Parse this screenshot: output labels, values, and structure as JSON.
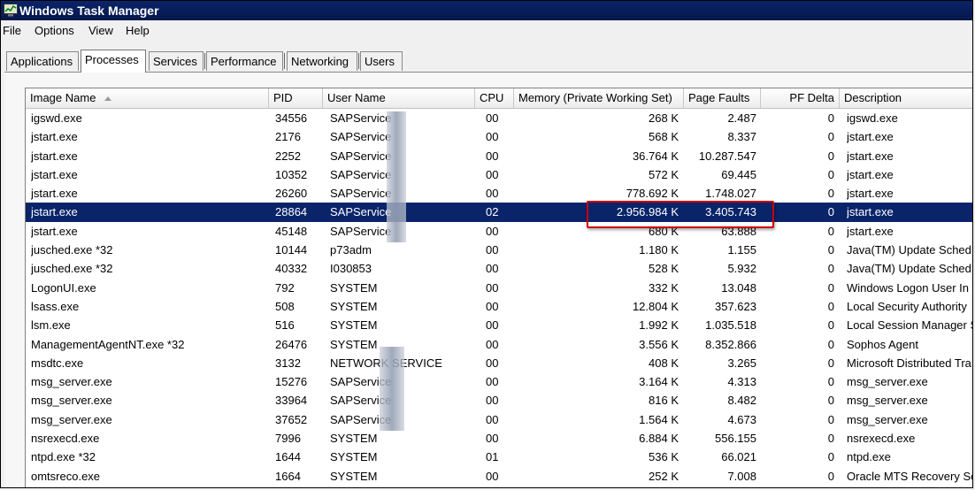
{
  "window": {
    "title": "Windows Task Manager"
  },
  "menu": [
    "File",
    "Options",
    "View",
    "Help"
  ],
  "tabs": [
    "Applications",
    "Processes",
    "Services",
    "Performance",
    "Networking",
    "Users"
  ],
  "active_tab": "Processes",
  "columns": [
    "Image Name",
    "PID",
    "User Name",
    "CPU",
    "Memory (Private Working Set)",
    "Page Faults",
    "PF Delta",
    "Description"
  ],
  "sort_column": "Image Name",
  "selected_row": 5,
  "highlight": {
    "row": 5,
    "columns": [
      "Memory (Private Working Set)",
      "Page Faults"
    ],
    "color": "#cc0000"
  },
  "colors": {
    "selection": "#0a246a",
    "titlebar": "#0a246a",
    "highlight_box": "#cc0000"
  },
  "rows": [
    {
      "name": "igswd.exe",
      "pid": "34556",
      "user": "SAPService",
      "cpu": "00",
      "mem": "268 K",
      "pf": "2.487",
      "pfd": "0",
      "desc": "igswd.exe"
    },
    {
      "name": "jstart.exe",
      "pid": "2176",
      "user": "SAPService",
      "cpu": "00",
      "mem": "568 K",
      "pf": "8.337",
      "pfd": "0",
      "desc": "jstart.exe"
    },
    {
      "name": "jstart.exe",
      "pid": "2252",
      "user": "SAPService",
      "cpu": "00",
      "mem": "36.764 K",
      "pf": "10.287.547",
      "pfd": "0",
      "desc": "jstart.exe"
    },
    {
      "name": "jstart.exe",
      "pid": "10352",
      "user": "SAPService",
      "cpu": "00",
      "mem": "572 K",
      "pf": "69.445",
      "pfd": "0",
      "desc": "jstart.exe"
    },
    {
      "name": "jstart.exe",
      "pid": "26260",
      "user": "SAPService",
      "cpu": "00",
      "mem": "778.692 K",
      "pf": "1.748.027",
      "pfd": "0",
      "desc": "jstart.exe"
    },
    {
      "name": "jstart.exe",
      "pid": "28864",
      "user": "SAPService",
      "cpu": "02",
      "mem": "2.956.984 K",
      "pf": "3.405.743",
      "pfd": "0",
      "desc": "jstart.exe"
    },
    {
      "name": "jstart.exe",
      "pid": "45148",
      "user": "SAPService",
      "cpu": "00",
      "mem": "680 K",
      "pf": "63.888",
      "pfd": "0",
      "desc": "jstart.exe"
    },
    {
      "name": "jusched.exe *32",
      "pid": "10144",
      "user": "p73adm",
      "cpu": "00",
      "mem": "1.180 K",
      "pf": "1.155",
      "pfd": "0",
      "desc": "Java(TM) Update Sched"
    },
    {
      "name": "jusched.exe *32",
      "pid": "40332",
      "user": "I030853",
      "cpu": "00",
      "mem": "528 K",
      "pf": "5.932",
      "pfd": "0",
      "desc": "Java(TM) Update Sched"
    },
    {
      "name": "LogonUI.exe",
      "pid": "792",
      "user": "SYSTEM",
      "cpu": "00",
      "mem": "332 K",
      "pf": "13.048",
      "pfd": "0",
      "desc": "Windows Logon User In"
    },
    {
      "name": "lsass.exe",
      "pid": "508",
      "user": "SYSTEM",
      "cpu": "00",
      "mem": "12.804 K",
      "pf": "357.623",
      "pfd": "0",
      "desc": "Local Security Authority"
    },
    {
      "name": "lsm.exe",
      "pid": "516",
      "user": "SYSTEM",
      "cpu": "00",
      "mem": "1.992 K",
      "pf": "1.035.518",
      "pfd": "0",
      "desc": "Local Session Manager S"
    },
    {
      "name": "ManagementAgentNT.exe *32",
      "pid": "26476",
      "user": "SYSTEM",
      "cpu": "00",
      "mem": "3.556 K",
      "pf": "8.352.866",
      "pfd": "0",
      "desc": "Sophos Agent"
    },
    {
      "name": "msdtc.exe",
      "pid": "3132",
      "user": "NETWORK SERVICE",
      "cpu": "00",
      "mem": "408 K",
      "pf": "3.265",
      "pfd": "0",
      "desc": "Microsoft Distributed Tra"
    },
    {
      "name": "msg_server.exe",
      "pid": "15276",
      "user": "SAPService",
      "cpu": "00",
      "mem": "3.164 K",
      "pf": "4.313",
      "pfd": "0",
      "desc": "msg_server.exe"
    },
    {
      "name": "msg_server.exe",
      "pid": "33964",
      "user": "SAPService",
      "cpu": "00",
      "mem": "816 K",
      "pf": "8.482",
      "pfd": "0",
      "desc": "msg_server.exe"
    },
    {
      "name": "msg_server.exe",
      "pid": "37652",
      "user": "SAPService",
      "cpu": "00",
      "mem": "1.564 K",
      "pf": "4.673",
      "pfd": "0",
      "desc": "msg_server.exe"
    },
    {
      "name": "nsrexecd.exe",
      "pid": "7996",
      "user": "SYSTEM",
      "cpu": "00",
      "mem": "6.884 K",
      "pf": "556.155",
      "pfd": "0",
      "desc": "nsrexecd.exe"
    },
    {
      "name": "ntpd.exe *32",
      "pid": "1644",
      "user": "SYSTEM",
      "cpu": "01",
      "mem": "536 K",
      "pf": "66.021",
      "pfd": "0",
      "desc": "ntpd.exe"
    },
    {
      "name": "omtsreco.exe",
      "pid": "1664",
      "user": "SYSTEM",
      "cpu": "00",
      "mem": "252 K",
      "pf": "7.008",
      "pfd": "0",
      "desc": "Oracle MTS Recovery Se"
    }
  ]
}
